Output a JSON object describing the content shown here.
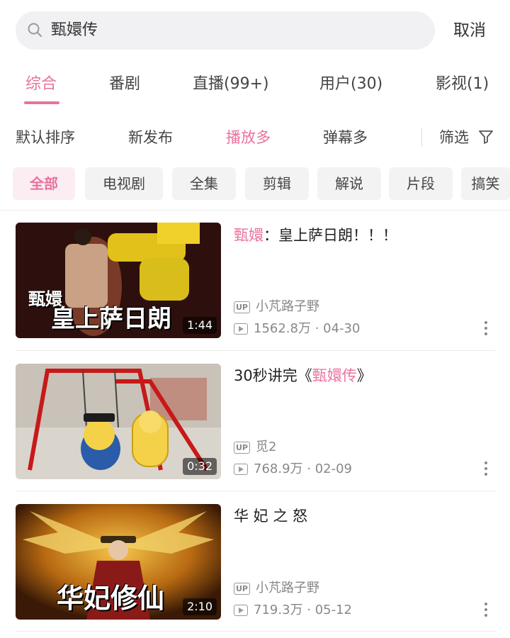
{
  "search": {
    "query": "甄嬛传",
    "cancel_label": "取消"
  },
  "tabs": [
    {
      "label": "综合",
      "active": true
    },
    {
      "label": "番剧",
      "active": false
    },
    {
      "label": "直播(99+)",
      "active": false
    },
    {
      "label": "用户(30)",
      "active": false
    },
    {
      "label": "影视(1)",
      "active": false
    }
  ],
  "sort": {
    "options": [
      "默认排序",
      "新发布",
      "播放多",
      "弹幕多"
    ],
    "active_index": 2,
    "filter_label": "筛选"
  },
  "categories": [
    "全部",
    "电视剧",
    "全集",
    "剪辑",
    "解说",
    "片段",
    "搞笑"
  ],
  "videos": [
    {
      "title_highlight": "甄嬛",
      "title_rest": "：皇上萨日朗！！！",
      "thumb_overlay_sub": "甄嬛",
      "thumb_overlay": "皇上萨日朗",
      "duration": "1:44",
      "up_badge": "UP",
      "uploader": "小芃路子野",
      "stats": "1562.8万 · 04-30"
    },
    {
      "title_pre": "30秒讲完《",
      "title_highlight": "甄嬛传",
      "title_post": "》",
      "duration": "0:32",
      "up_badge": "UP",
      "uploader": "觅2",
      "stats": "768.9万 · 02-09"
    },
    {
      "title": "华 妃 之 怒",
      "thumb_overlay": "华妃修仙",
      "duration": "2:10",
      "up_badge": "UP",
      "uploader": "小芃路子野",
      "stats": "719.3万 · 05-12"
    }
  ],
  "colors": {
    "accent": "#e8739f",
    "chip_bg": "#f3f3f3",
    "search_bg": "#f1f1f3"
  }
}
